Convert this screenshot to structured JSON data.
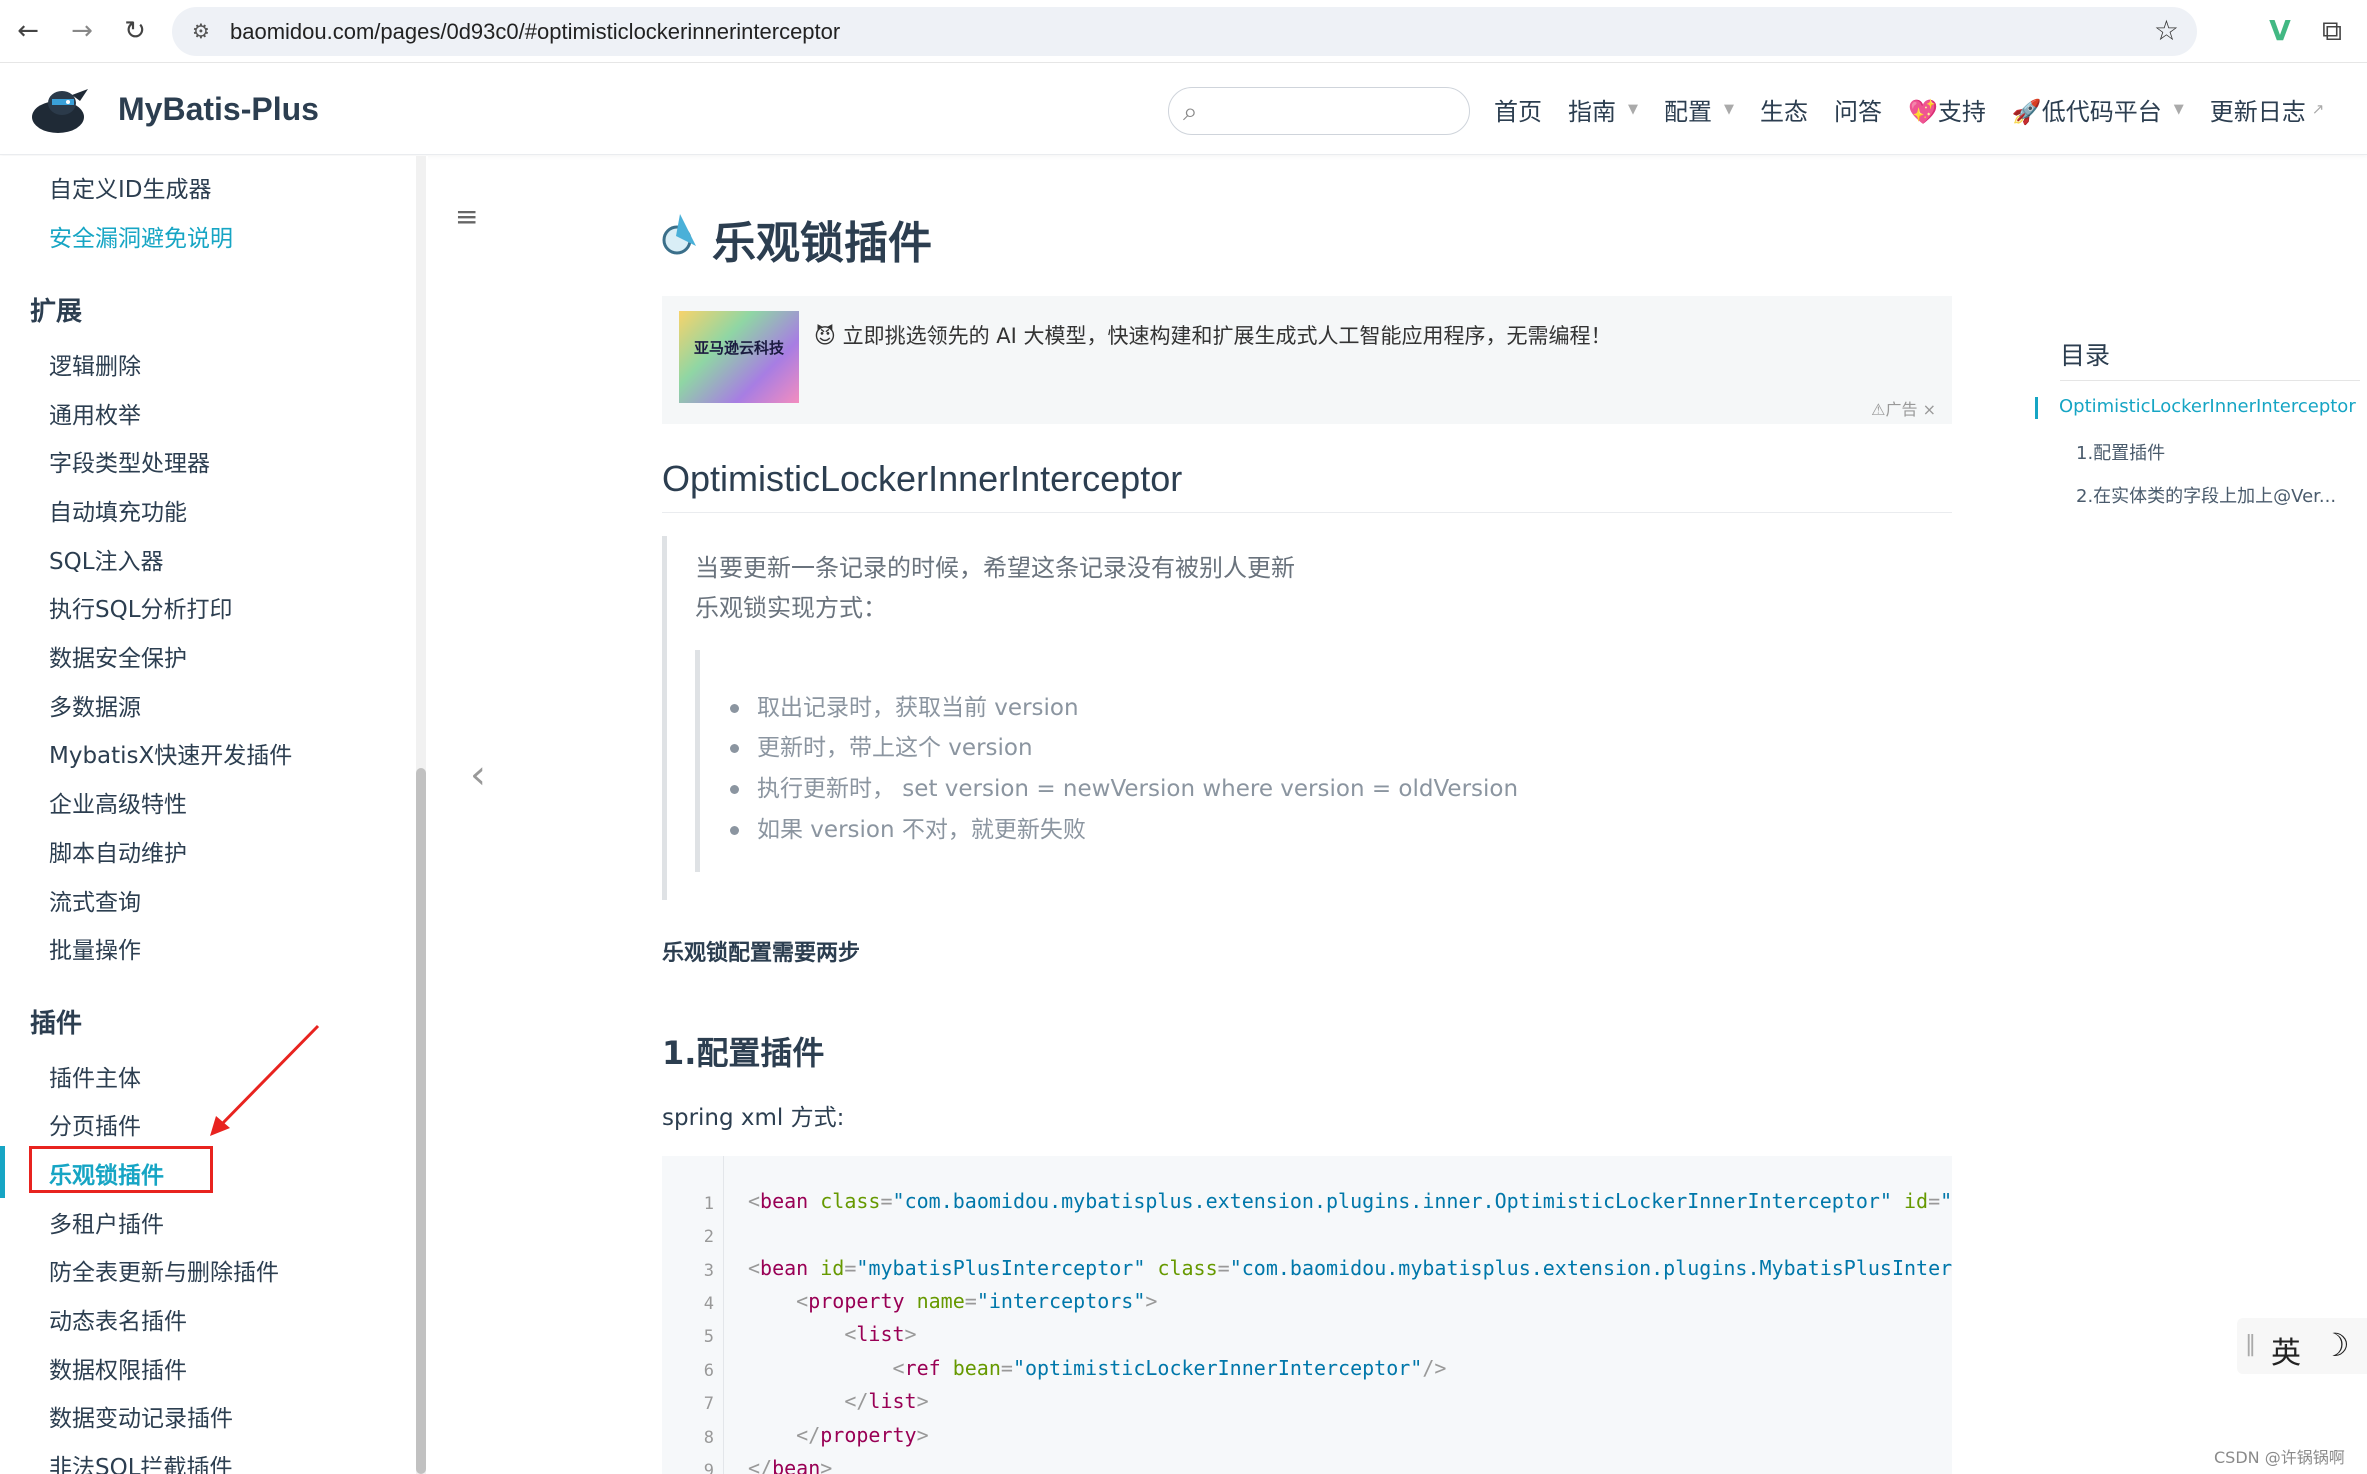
{
  "browser": {
    "url": "baomidou.com/pages/0d93c0/#optimisticlockerinnerinterceptor",
    "back_icon": "arrow-left",
    "forward_icon": "arrow-right",
    "reload_icon": "reload",
    "bookmark_icon": "star",
    "extension_icons": [
      "vue-devtools-icon",
      "puzzle-icon"
    ]
  },
  "header": {
    "brand": "MyBatis-Plus",
    "search_placeholder": "",
    "nav": [
      {
        "label": "首页",
        "dropdown": false
      },
      {
        "label": "指南",
        "dropdown": true
      },
      {
        "label": "配置",
        "dropdown": true
      },
      {
        "label": "生态",
        "dropdown": false
      },
      {
        "label": "问答",
        "dropdown": false
      },
      {
        "label": "💖支持",
        "dropdown": false
      },
      {
        "label": "🚀低代码平台",
        "dropdown": true
      },
      {
        "label": "更新日志",
        "dropdown": false,
        "external": true
      }
    ]
  },
  "sidebar": {
    "top_items": [
      "自定义ID生成器",
      "安全漏洞避免说明"
    ],
    "groups": [
      {
        "title": "扩展",
        "items": [
          "逻辑删除",
          "通用枚举",
          "字段类型处理器",
          "自动填充功能",
          "SQL注入器",
          "执行SQL分析打印",
          "数据安全保护",
          "多数据源",
          "MybatisX快速开发插件",
          "企业高级特性",
          "脚本自动维护",
          "流式查询",
          "批量操作"
        ]
      },
      {
        "title": "插件",
        "items": [
          "插件主体",
          "分页插件",
          "乐观锁插件",
          "多租户插件",
          "防全表更新与删除插件",
          "动态表名插件",
          "数据权限插件",
          "数据变动记录插件",
          "非法SQL拦截插件"
        ]
      }
    ],
    "active_item": "乐观锁插件",
    "accent_color": "#16a5c4",
    "highlight_color": "#e8231f"
  },
  "content": {
    "title": "乐观锁插件",
    "ad": {
      "image_text": "亚马逊云科技",
      "text": "😈 立即挑选领先的 AI 大模型，快速构建和扩展生成式人工智能应用程序，无需编程！",
      "meta": "⚠广告  ×"
    },
    "h2": "OptimisticLockerInnerInterceptor",
    "quote_lines": [
      "当要更新一条记录的时候，希望这条记录没有被别人更新",
      "乐观锁实现方式："
    ],
    "quote_list": [
      "取出记录时，获取当前 version",
      "更新时，带上这个 version",
      "执行更新时， set version = newVersion where version = oldVersion",
      "如果 version 不对，就更新失败"
    ],
    "bold_line": "乐观锁配置需要两步",
    "h3": "1.配置插件",
    "para": "spring xml 方式:",
    "code_line_numbers": [
      "1",
      "2",
      "3",
      "4",
      "5",
      "6",
      "7",
      "8",
      "9"
    ],
    "code": {
      "l1_attr1": "class",
      "l1_val1": "\"com.baomidou.mybatisplus.extension.plugins.inner.OptimisticLockerInnerInterceptor\"",
      "l1_attr2": "id",
      "l1_val2": "\"op",
      "l3_attr1": "id",
      "l3_val1": "\"mybatisPlusInterceptor\"",
      "l3_attr2": "class",
      "l3_val2": "\"com.baomidou.mybatisplus.extension.plugins.MybatisPlusInterce",
      "l4_attr": "name",
      "l4_val": "\"interceptors\"",
      "l6_attr": "bean",
      "l6_val": "\"optimisticLockerInnerInterceptor\""
    }
  },
  "toc": {
    "title": "目录",
    "items": [
      "OptimisticLockerInnerInterceptor",
      "1.配置插件",
      "2.在实体类的字段上加上@Ver..."
    ]
  },
  "float_tools": {
    "separator": "‖",
    "lang": "英",
    "theme_icon": "moon"
  },
  "watermark": "CSDN @许锅锅啊"
}
